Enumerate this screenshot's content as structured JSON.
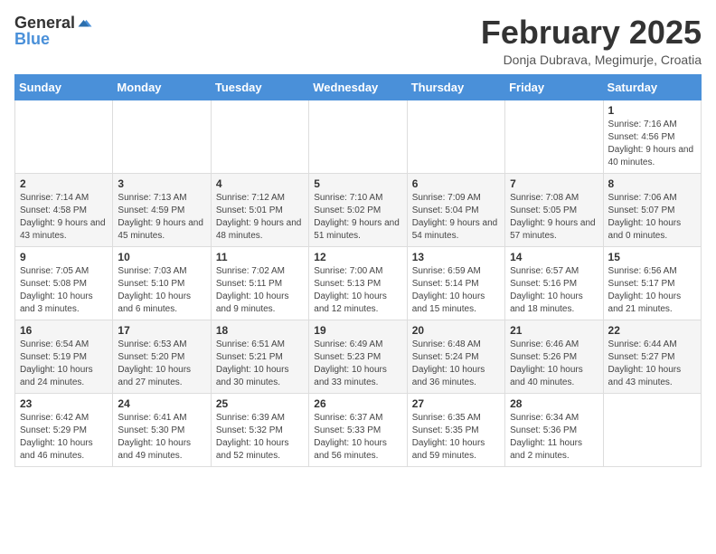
{
  "header": {
    "logo_general": "General",
    "logo_blue": "Blue",
    "month_title": "February 2025",
    "subtitle": "Donja Dubrava, Megimurje, Croatia"
  },
  "weekdays": [
    "Sunday",
    "Monday",
    "Tuesday",
    "Wednesday",
    "Thursday",
    "Friday",
    "Saturday"
  ],
  "weeks": [
    [
      {
        "day": "",
        "info": ""
      },
      {
        "day": "",
        "info": ""
      },
      {
        "day": "",
        "info": ""
      },
      {
        "day": "",
        "info": ""
      },
      {
        "day": "",
        "info": ""
      },
      {
        "day": "",
        "info": ""
      },
      {
        "day": "1",
        "info": "Sunrise: 7:16 AM\nSunset: 4:56 PM\nDaylight: 9 hours and 40 minutes."
      }
    ],
    [
      {
        "day": "2",
        "info": "Sunrise: 7:14 AM\nSunset: 4:58 PM\nDaylight: 9 hours and 43 minutes."
      },
      {
        "day": "3",
        "info": "Sunrise: 7:13 AM\nSunset: 4:59 PM\nDaylight: 9 hours and 45 minutes."
      },
      {
        "day": "4",
        "info": "Sunrise: 7:12 AM\nSunset: 5:01 PM\nDaylight: 9 hours and 48 minutes."
      },
      {
        "day": "5",
        "info": "Sunrise: 7:10 AM\nSunset: 5:02 PM\nDaylight: 9 hours and 51 minutes."
      },
      {
        "day": "6",
        "info": "Sunrise: 7:09 AM\nSunset: 5:04 PM\nDaylight: 9 hours and 54 minutes."
      },
      {
        "day": "7",
        "info": "Sunrise: 7:08 AM\nSunset: 5:05 PM\nDaylight: 9 hours and 57 minutes."
      },
      {
        "day": "8",
        "info": "Sunrise: 7:06 AM\nSunset: 5:07 PM\nDaylight: 10 hours and 0 minutes."
      }
    ],
    [
      {
        "day": "9",
        "info": "Sunrise: 7:05 AM\nSunset: 5:08 PM\nDaylight: 10 hours and 3 minutes."
      },
      {
        "day": "10",
        "info": "Sunrise: 7:03 AM\nSunset: 5:10 PM\nDaylight: 10 hours and 6 minutes."
      },
      {
        "day": "11",
        "info": "Sunrise: 7:02 AM\nSunset: 5:11 PM\nDaylight: 10 hours and 9 minutes."
      },
      {
        "day": "12",
        "info": "Sunrise: 7:00 AM\nSunset: 5:13 PM\nDaylight: 10 hours and 12 minutes."
      },
      {
        "day": "13",
        "info": "Sunrise: 6:59 AM\nSunset: 5:14 PM\nDaylight: 10 hours and 15 minutes."
      },
      {
        "day": "14",
        "info": "Sunrise: 6:57 AM\nSunset: 5:16 PM\nDaylight: 10 hours and 18 minutes."
      },
      {
        "day": "15",
        "info": "Sunrise: 6:56 AM\nSunset: 5:17 PM\nDaylight: 10 hours and 21 minutes."
      }
    ],
    [
      {
        "day": "16",
        "info": "Sunrise: 6:54 AM\nSunset: 5:19 PM\nDaylight: 10 hours and 24 minutes."
      },
      {
        "day": "17",
        "info": "Sunrise: 6:53 AM\nSunset: 5:20 PM\nDaylight: 10 hours and 27 minutes."
      },
      {
        "day": "18",
        "info": "Sunrise: 6:51 AM\nSunset: 5:21 PM\nDaylight: 10 hours and 30 minutes."
      },
      {
        "day": "19",
        "info": "Sunrise: 6:49 AM\nSunset: 5:23 PM\nDaylight: 10 hours and 33 minutes."
      },
      {
        "day": "20",
        "info": "Sunrise: 6:48 AM\nSunset: 5:24 PM\nDaylight: 10 hours and 36 minutes."
      },
      {
        "day": "21",
        "info": "Sunrise: 6:46 AM\nSunset: 5:26 PM\nDaylight: 10 hours and 40 minutes."
      },
      {
        "day": "22",
        "info": "Sunrise: 6:44 AM\nSunset: 5:27 PM\nDaylight: 10 hours and 43 minutes."
      }
    ],
    [
      {
        "day": "23",
        "info": "Sunrise: 6:42 AM\nSunset: 5:29 PM\nDaylight: 10 hours and 46 minutes."
      },
      {
        "day": "24",
        "info": "Sunrise: 6:41 AM\nSunset: 5:30 PM\nDaylight: 10 hours and 49 minutes."
      },
      {
        "day": "25",
        "info": "Sunrise: 6:39 AM\nSunset: 5:32 PM\nDaylight: 10 hours and 52 minutes."
      },
      {
        "day": "26",
        "info": "Sunrise: 6:37 AM\nSunset: 5:33 PM\nDaylight: 10 hours and 56 minutes."
      },
      {
        "day": "27",
        "info": "Sunrise: 6:35 AM\nSunset: 5:35 PM\nDaylight: 10 hours and 59 minutes."
      },
      {
        "day": "28",
        "info": "Sunrise: 6:34 AM\nSunset: 5:36 PM\nDaylight: 11 hours and 2 minutes."
      },
      {
        "day": "",
        "info": ""
      }
    ]
  ]
}
